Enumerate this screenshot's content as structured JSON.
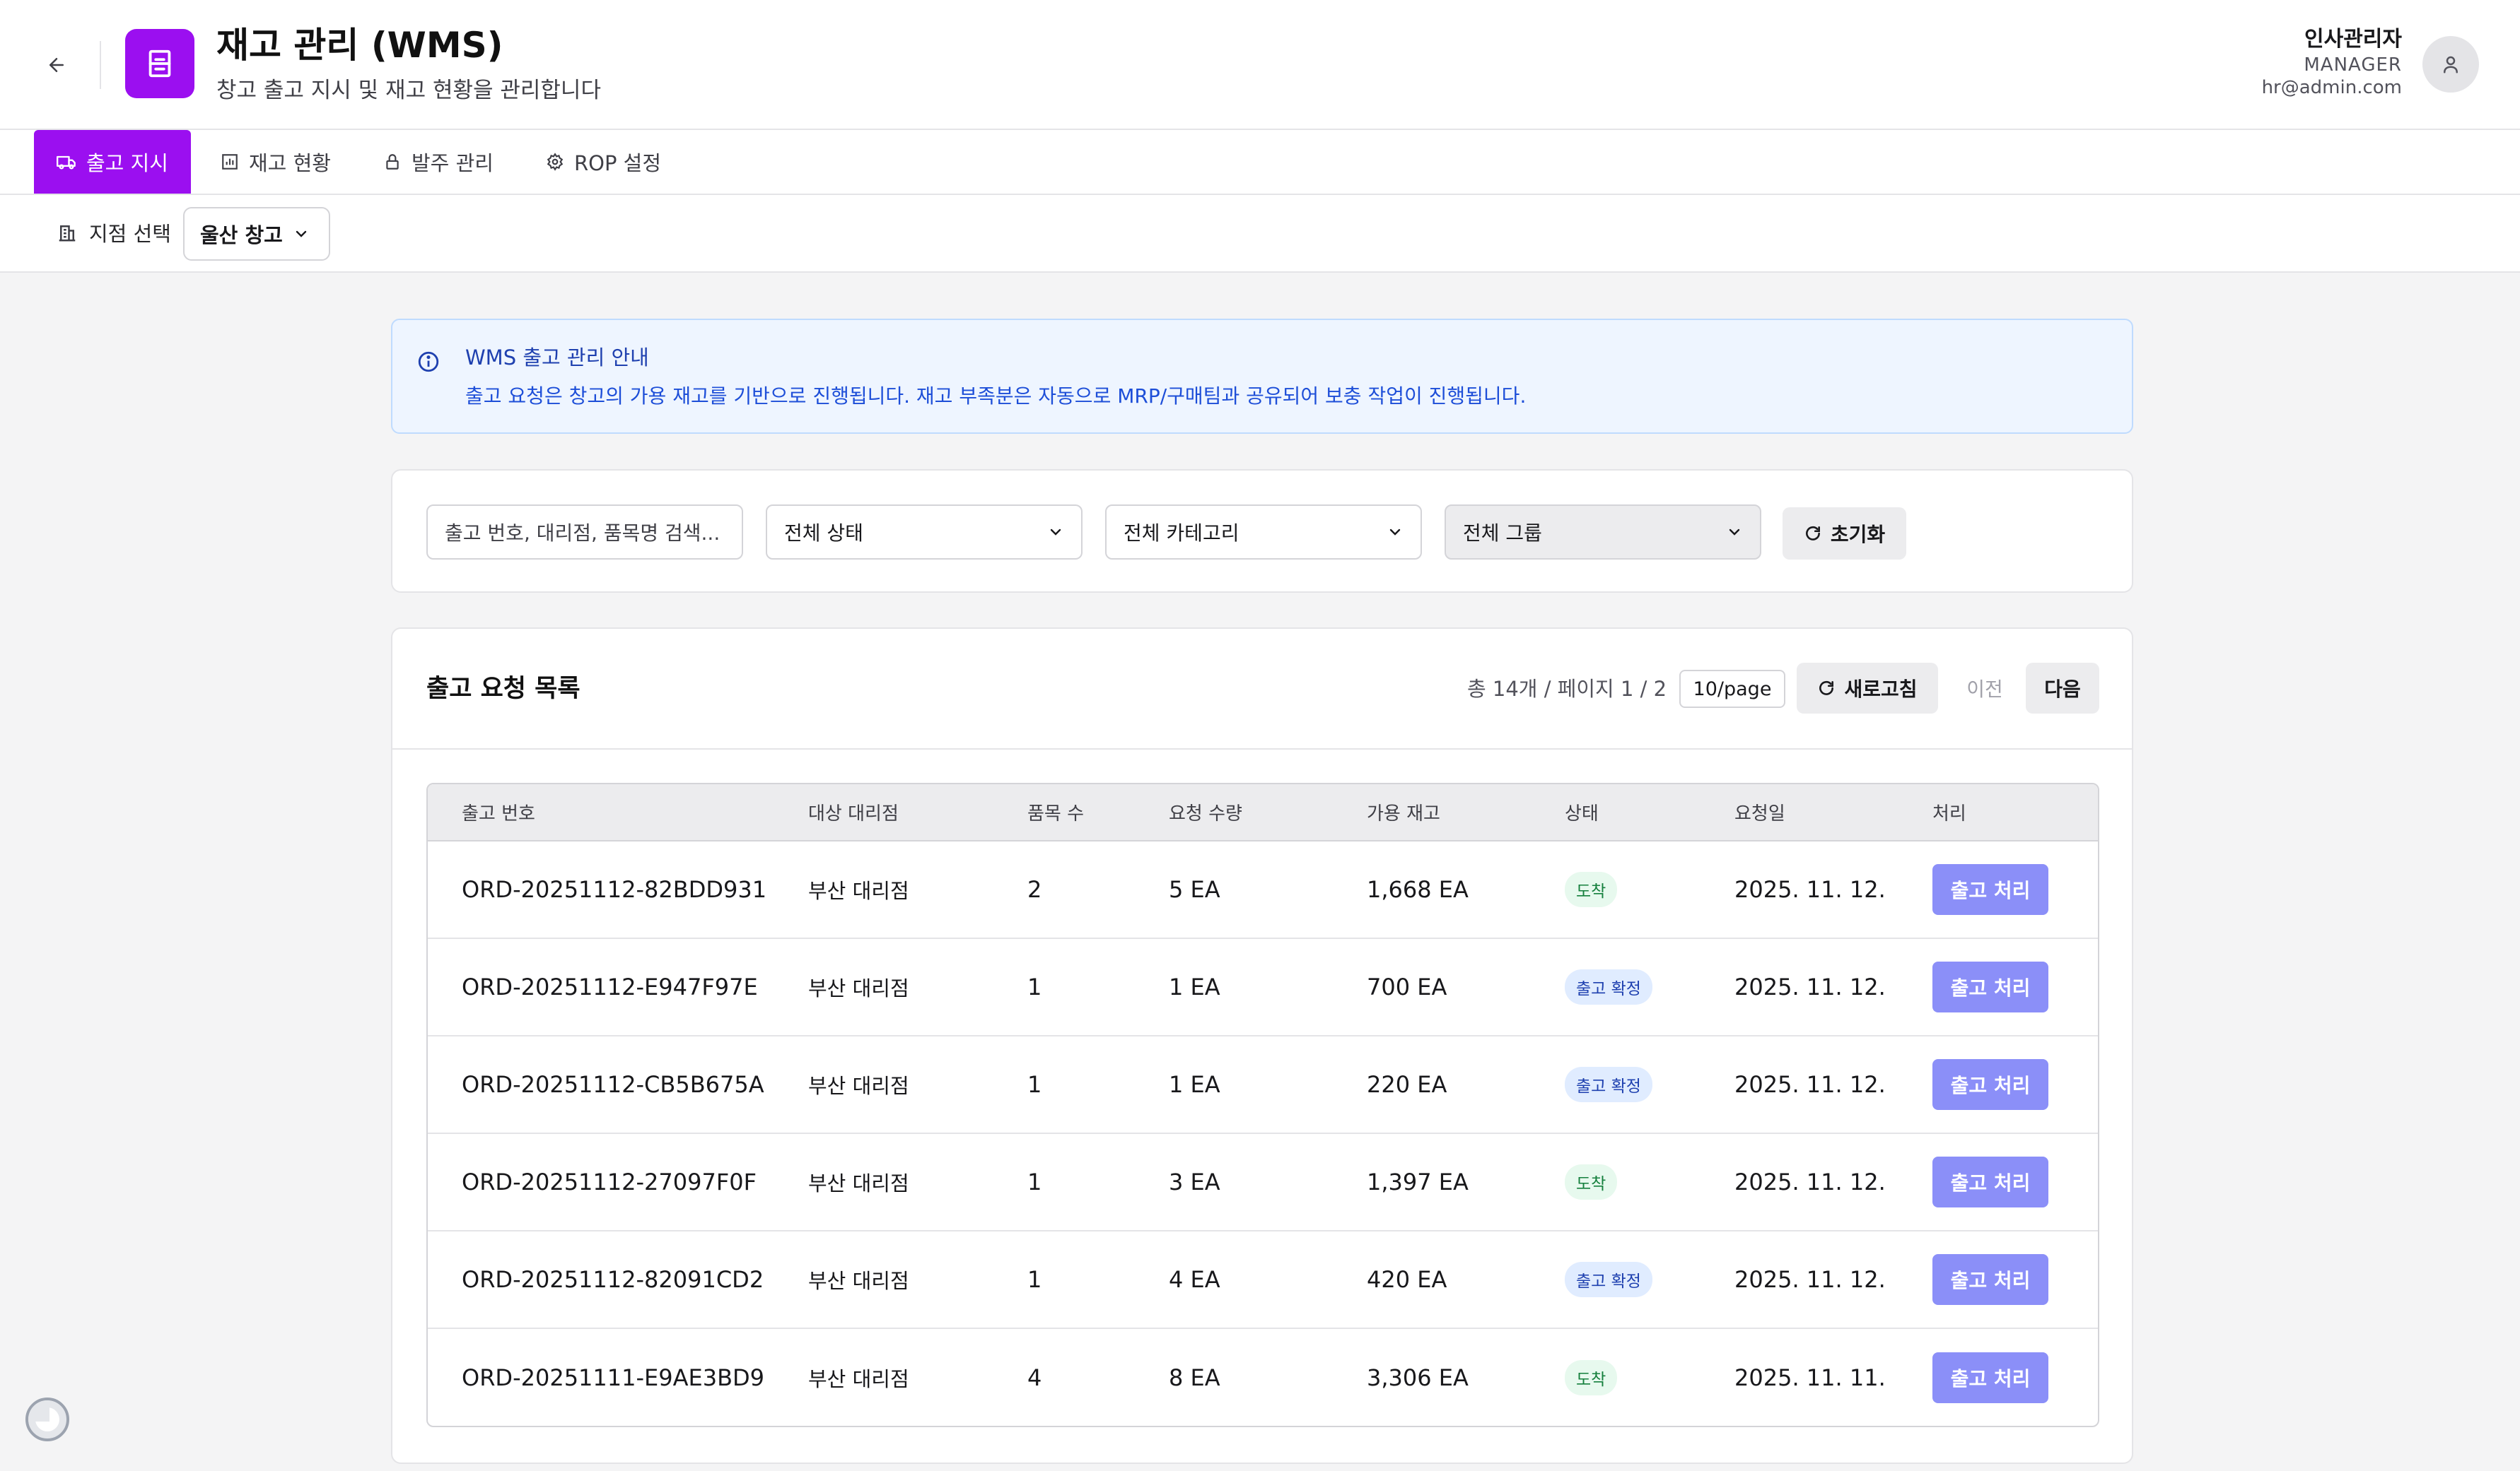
{
  "header": {
    "title": "재고 관리 (WMS)",
    "subtitle": "창고 출고 지시 및 재고 현황을 관리합니다",
    "user": {
      "name": "인사관리자",
      "role": "MANAGER",
      "email": "hr@admin.com"
    }
  },
  "tabs": [
    {
      "label": "출고 지시",
      "icon": "truck-icon",
      "active": true
    },
    {
      "label": "재고 현황",
      "icon": "chart-icon",
      "active": false
    },
    {
      "label": "발주 관리",
      "icon": "lock-icon",
      "active": false
    },
    {
      "label": "ROP 설정",
      "icon": "gear-icon",
      "active": false
    }
  ],
  "branch": {
    "label": "지점 선택",
    "selected": "울산 창고"
  },
  "info": {
    "title": "WMS 출고 관리 안내",
    "text": "출고 요청은 창고의 가용 재고를 기반으로 진행됩니다. 재고 부족분은 자동으로 MRP/구매팀과 공유되어 보충 작업이 진행됩니다."
  },
  "filters": {
    "search_placeholder": "출고 번호, 대리점, 품목명 검색...",
    "status": "전체 상태",
    "category": "전체 카테고리",
    "group": "전체 그룹",
    "reset_label": "초기화"
  },
  "list": {
    "title": "출고 요청 목록",
    "meta": "총 14개 / 페이지 1 / 2",
    "per_page": "10/page",
    "refresh_label": "새로고침",
    "prev_label": "이전",
    "next_label": "다음",
    "columns": [
      "출고 번호",
      "대상 대리점",
      "품목 수",
      "요청 수량",
      "가용 재고",
      "상태",
      "요청일",
      "처리"
    ],
    "rows": [
      {
        "id": "ORD-20251112-82BDD931",
        "branch": "부산 대리점",
        "items": "2",
        "qty": "5 EA",
        "stock": "1,668 EA",
        "status": "도착",
        "status_type": "arrived",
        "date": "2025. 11. 12.",
        "action": "출고 처리"
      },
      {
        "id": "ORD-20251112-E947F97E",
        "branch": "부산 대리점",
        "items": "1",
        "qty": "1 EA",
        "stock": "700 EA",
        "status": "출고 확정",
        "status_type": "confirmed",
        "date": "2025. 11. 12.",
        "action": "출고 처리"
      },
      {
        "id": "ORD-20251112-CB5B675A",
        "branch": "부산 대리점",
        "items": "1",
        "qty": "1 EA",
        "stock": "220 EA",
        "status": "출고 확정",
        "status_type": "confirmed",
        "date": "2025. 11. 12.",
        "action": "출고 처리"
      },
      {
        "id": "ORD-20251112-27097F0F",
        "branch": "부산 대리점",
        "items": "1",
        "qty": "3 EA",
        "stock": "1,397 EA",
        "status": "도착",
        "status_type": "arrived",
        "date": "2025. 11. 12.",
        "action": "출고 처리"
      },
      {
        "id": "ORD-20251112-82091CD2",
        "branch": "부산 대리점",
        "items": "1",
        "qty": "4 EA",
        "stock": "420 EA",
        "status": "출고 확정",
        "status_type": "confirmed",
        "date": "2025. 11. 12.",
        "action": "출고 처리"
      },
      {
        "id": "ORD-20251111-E9AE3BD9",
        "branch": "부산 대리점",
        "items": "4",
        "qty": "8 EA",
        "stock": "3,306 EA",
        "status": "도착",
        "status_type": "arrived",
        "date": "2025. 11. 11.",
        "action": "출고 처리"
      }
    ]
  },
  "colors": {
    "accent": "#9b0ff0",
    "action": "#8b8ff8",
    "info_bg": "#eef5ff"
  }
}
